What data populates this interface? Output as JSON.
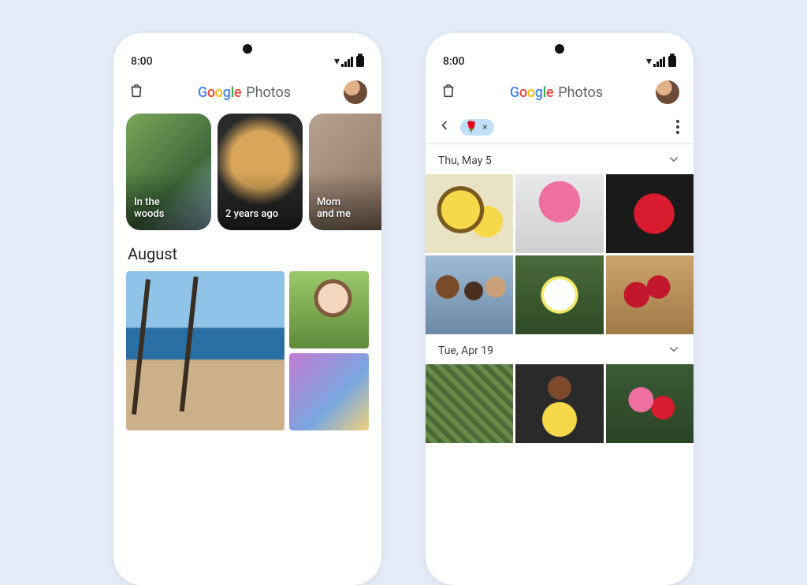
{
  "status": {
    "time": "8:00"
  },
  "brand": {
    "google": "Google",
    "photos": "Photos"
  },
  "left": {
    "memories": [
      {
        "label": "In the\nwoods"
      },
      {
        "label": "2 years ago"
      },
      {
        "label": "Mom\nand me"
      }
    ],
    "section": "August"
  },
  "right": {
    "search_chip_emoji": "🌹",
    "search_chip_close": "×",
    "dates": [
      {
        "label": "Thu, May 5"
      },
      {
        "label": "Tue, Apr 19"
      }
    ]
  }
}
